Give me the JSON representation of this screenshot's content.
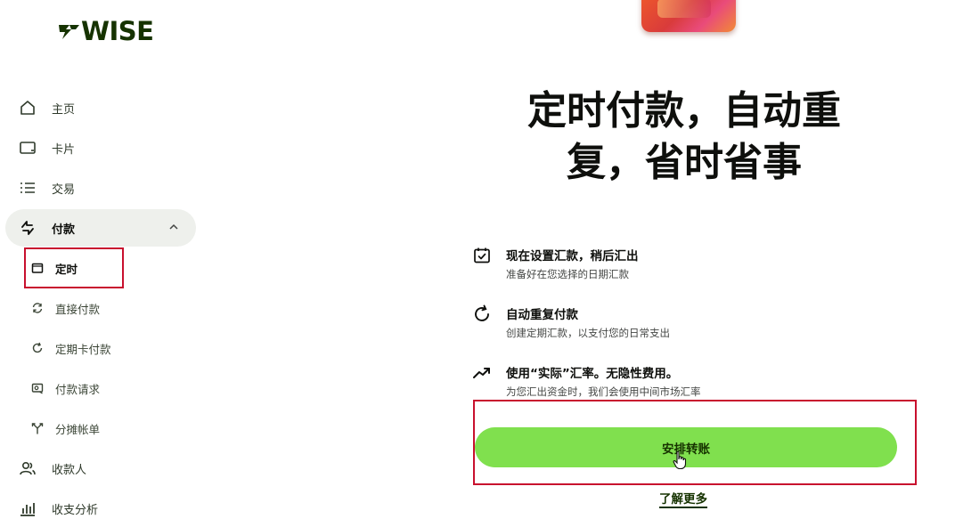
{
  "brand": {
    "logo_text": "WISE",
    "accent_color": "#80e04e",
    "dark_green": "#163300"
  },
  "sidebar": {
    "items": [
      {
        "label": "主页",
        "icon": "home-icon"
      },
      {
        "label": "卡片",
        "icon": "card-icon"
      },
      {
        "label": "交易",
        "icon": "list-icon"
      },
      {
        "label": "付款",
        "icon": "transfer-arrows-icon",
        "expanded": true
      },
      {
        "label": "收款人",
        "icon": "recipients-icon"
      },
      {
        "label": "收支分析",
        "icon": "bar-chart-icon"
      }
    ],
    "payments_subitems": [
      {
        "label": "定时",
        "icon": "calendar-icon",
        "current": true
      },
      {
        "label": "直接付款",
        "icon": "sync-icon"
      },
      {
        "label": "定期卡付款",
        "icon": "refresh-icon"
      },
      {
        "label": "付款请求",
        "icon": "request-icon"
      },
      {
        "label": "分摊帐单",
        "icon": "split-icon"
      }
    ]
  },
  "main": {
    "headline_line1": "定时付款，自动重",
    "headline_line2": "复，省时省事",
    "features": [
      {
        "title": "现在设置汇款，稍后汇出",
        "desc": "准备好在您选择的日期汇款",
        "icon": "calendar-check-icon"
      },
      {
        "title": "自动重复付款",
        "desc": "创建定期汇款，以支付您的日常支出",
        "icon": "refresh-icon"
      },
      {
        "title": "使用“实际”汇率。无隐性费用。",
        "desc": "为您汇出资金时，我们会使用中间市场汇率",
        "icon": "trend-up-icon"
      }
    ],
    "cta_label": "安排转账",
    "learn_more_label": "了解更多"
  }
}
